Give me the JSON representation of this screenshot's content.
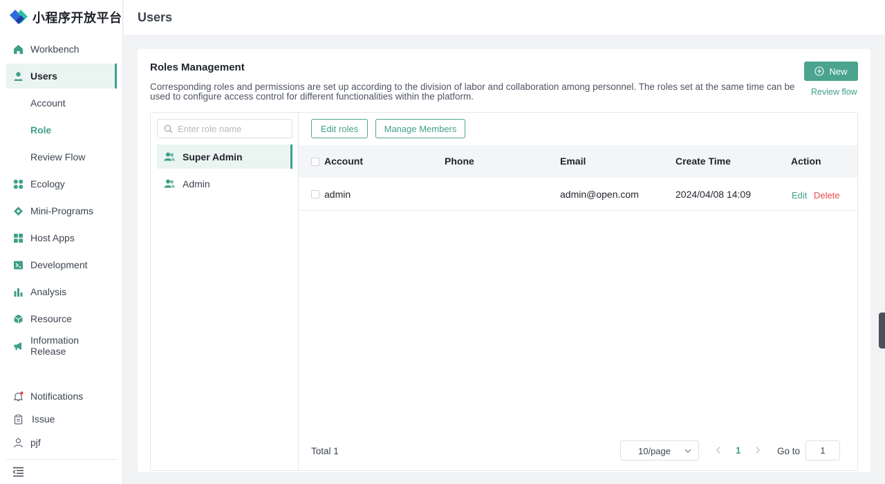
{
  "brand": {
    "name": "小程序开放平台",
    "logo_icon": "diamond-logo-icon"
  },
  "sidebar": {
    "items": [
      {
        "key": "workbench",
        "label": "Workbench",
        "icon": "home-icon"
      },
      {
        "key": "users",
        "label": "Users",
        "icon": "user-icon",
        "active": true
      },
      {
        "key": "account",
        "label": "Account",
        "sub": true
      },
      {
        "key": "role",
        "label": "Role",
        "sub": true,
        "current": true
      },
      {
        "key": "review-flow",
        "label": "Review Flow",
        "sub": true
      },
      {
        "key": "ecology",
        "label": "Ecology",
        "icon": "grid-dots-icon"
      },
      {
        "key": "mini-programs",
        "label": "Mini-Programs",
        "icon": "diamond-icon"
      },
      {
        "key": "host-apps",
        "label": "Host Apps",
        "icon": "apps-icon"
      },
      {
        "key": "development",
        "label": "Development",
        "icon": "terminal-icon"
      },
      {
        "key": "analysis",
        "label": "Analysis",
        "icon": "bar-chart-icon"
      },
      {
        "key": "resource",
        "label": "Resource",
        "icon": "cube-icon"
      },
      {
        "key": "information-release",
        "label": "Information Release",
        "icon": "megaphone-icon"
      }
    ],
    "bottom": [
      {
        "key": "notifications",
        "label": "Notifications",
        "icon": "bell-icon",
        "has_badge": true
      },
      {
        "key": "issue",
        "label": "Issue",
        "icon": "clipboard-icon"
      },
      {
        "key": "user",
        "label": "pjf",
        "icon": "person-outline-icon"
      }
    ],
    "collapse_icon": "collapse-menu-icon"
  },
  "header": {
    "title": "Users"
  },
  "card": {
    "title": "Roles Management",
    "description": "Corresponding roles and permissions are set up according to the division of labor and collaboration among personnel. The roles set at the same time can be used to configure access control for different functionalities within the platform.",
    "new_button": "New",
    "review_flow_link": "Review flow"
  },
  "roles": {
    "search_placeholder": "Enter role name",
    "items": [
      {
        "label": "Super Admin",
        "active": true
      },
      {
        "label": "Admin",
        "active": false
      }
    ]
  },
  "members": {
    "edit_roles": "Edit roles",
    "manage_members": "Manage Members",
    "columns": [
      "Account",
      "Phone",
      "Email",
      "Create Time",
      "Action"
    ],
    "rows": [
      {
        "account": "admin",
        "phone": "",
        "email": "admin@open.com",
        "create_time": "2024/04/08 14:09",
        "edit": "Edit",
        "delete": "Delete"
      }
    ],
    "total_label": "Total 1",
    "page_size": "10/page",
    "current_page": "1",
    "goto_label": "Go to",
    "goto_value": "1"
  },
  "colors": {
    "accent": "#3f9f89",
    "accent_button": "#4aa48e",
    "danger": "#f04848",
    "active_bg": "#eaf4f1"
  }
}
